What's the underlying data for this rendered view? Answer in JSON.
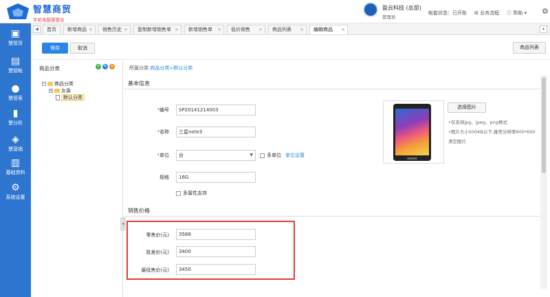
{
  "header": {
    "brand_title": "智慧商贸",
    "brand_subtitle": "手机电脑慧管店",
    "company": "盈云科技 (总部)",
    "role": "管理员",
    "account_status": "帐套状态：已开账",
    "flow": "业务流程",
    "help": "帮助"
  },
  "sidebar": {
    "items": [
      {
        "label": "慧管货",
        "icon": "goods-icon"
      },
      {
        "label": "慧管帐",
        "icon": "ledger-icon"
      },
      {
        "label": "慧管客",
        "icon": "customers-icon"
      },
      {
        "label": "慧分析",
        "icon": "analysis-icon"
      },
      {
        "label": "慧营销",
        "icon": "marketing-icon"
      },
      {
        "label": "基础资料",
        "icon": "basic-data-icon"
      },
      {
        "label": "系统设置",
        "icon": "settings-icon"
      }
    ]
  },
  "tabs": [
    {
      "label": "首页",
      "closable": false
    },
    {
      "label": "新增商品",
      "closable": true
    },
    {
      "label": "销售历史",
      "closable": true
    },
    {
      "label": "复制新增销售单",
      "closable": true
    },
    {
      "label": "新增销售单",
      "closable": true
    },
    {
      "label": "低价销售",
      "closable": true
    },
    {
      "label": "商品列表",
      "closable": true
    },
    {
      "label": "编辑商品",
      "closable": true,
      "active": true
    }
  ],
  "toolbar": {
    "save_label": "保存",
    "cancel_label": "取消",
    "list_label": "商品列表"
  },
  "category_panel": {
    "title": "商品分类",
    "tree": {
      "root": "商品分类",
      "child1": "女装",
      "child2": "默认分类"
    }
  },
  "form": {
    "breadcrumb_prefix": "所属分类:",
    "breadcrumb_path": "商品分类>默认分类",
    "section_basic": "基本信息",
    "section_price": "销售价格",
    "code_label": "编号",
    "code_value": "SP20141214003",
    "name_label": "名称",
    "name_value": "三星note3",
    "unit_label": "单位",
    "unit_value": "台",
    "multi_unit_label": "多单位",
    "unit_settings_link": "单位设置",
    "spec_label": "规格",
    "spec_value": "16G",
    "multi_attr_label": "多属性支持",
    "choose_image_label": "选择图片",
    "image_note1": "•仅支持jpg、jpeg、png格式",
    "image_note2": "•图片大小500KB以下,推荐分辨率600*600",
    "clear_image_link": "清空图片",
    "retail_label": "零售价(元)",
    "retail_value": "3588",
    "wholesale_label": "批发价(元)",
    "wholesale_value": "3400",
    "min_label": "最低售价(元)",
    "min_value": "3450"
  },
  "colors": {
    "sidebar": "#2e75cf",
    "primary_button": "#2a86e6",
    "highlight": "#e53935",
    "required": "#e04343"
  }
}
